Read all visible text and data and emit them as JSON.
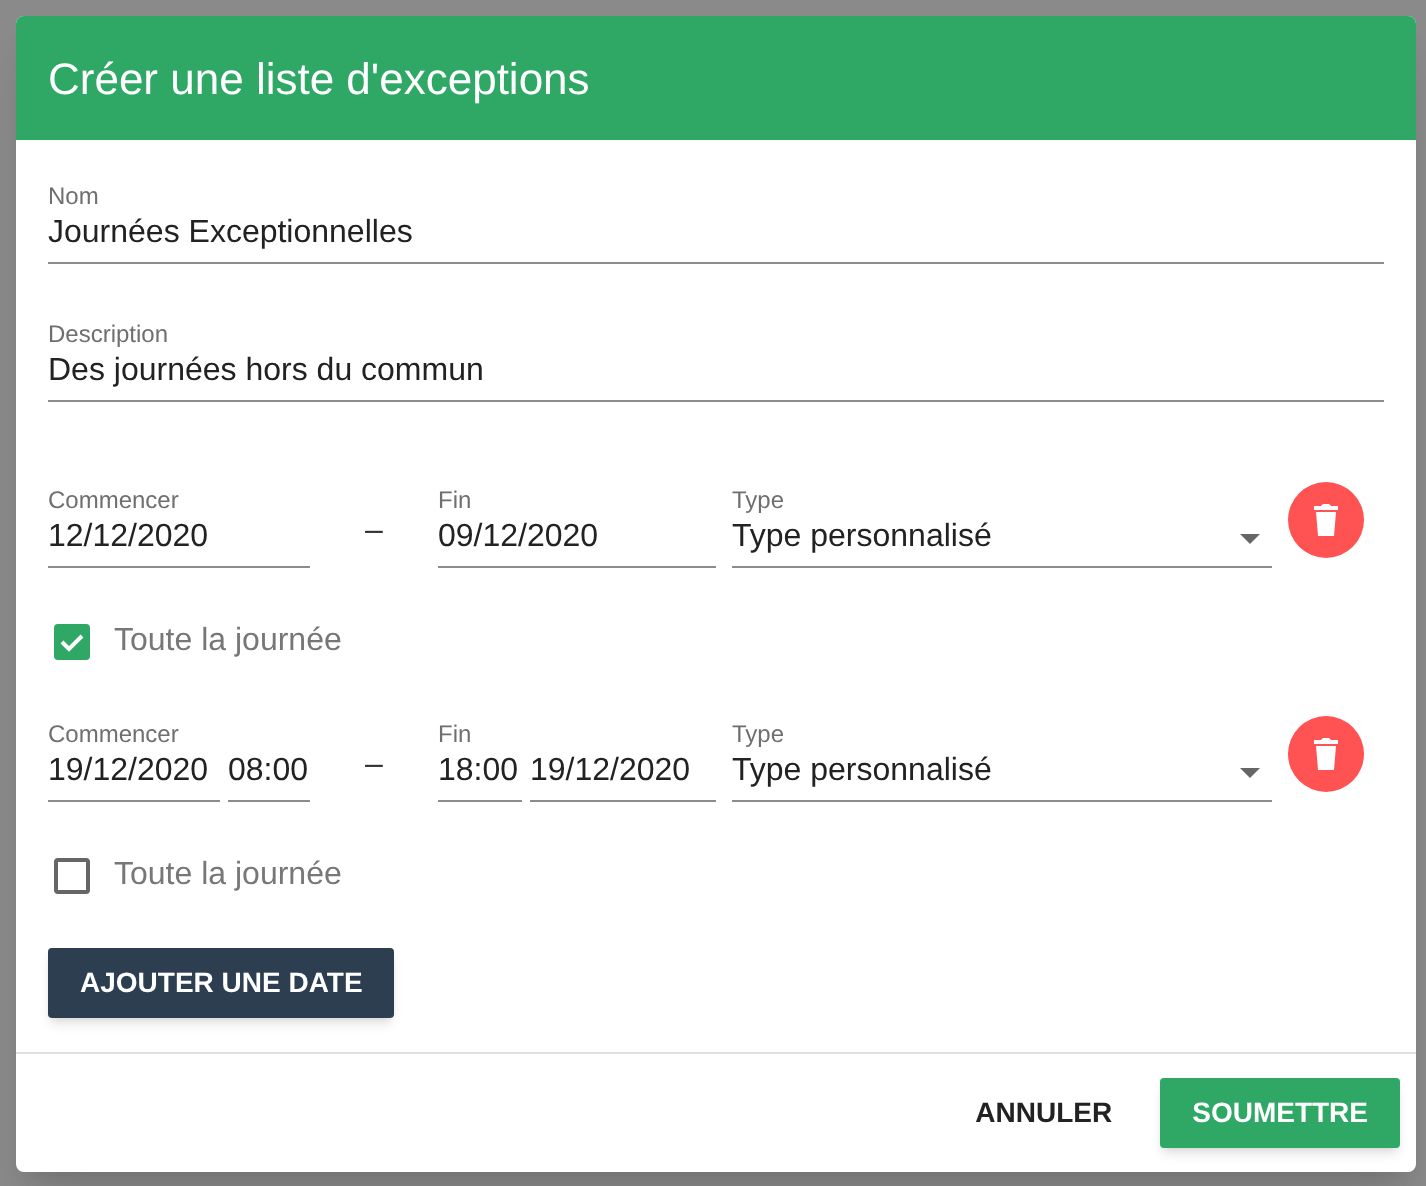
{
  "dialog": {
    "title": "Créer une liste d'exceptions",
    "fields": [
      {
        "label": "Nom",
        "value": "Journées Exceptionnelles"
      },
      {
        "label": "Description",
        "value": "Des journées hors du commun"
      }
    ],
    "dates": [
      {
        "start_label": "Commencer",
        "start_date": "12/12/2020",
        "separator": "–",
        "end_label": "Fin",
        "end_date": "09/12/2020",
        "type_label": "Type",
        "type": "Type personnalisé",
        "all_day": {
          "label": "Toute la journée",
          "checked": true
        }
      },
      {
        "start_label": "Commencer",
        "start_date": "19/12/2020",
        "start_time": "08:00",
        "separator": "–",
        "end_label": "Fin",
        "end_time": "18:00",
        "end_date": "19/12/2020",
        "type_label": "Type",
        "type": "Type personnalisé",
        "all_day": {
          "label": "Toute la journée",
          "checked": false
        }
      }
    ],
    "add_button": "AJOUTER UNE DATE",
    "buttons": [
      {
        "label": "ANNULER",
        "kind": "text"
      },
      {
        "label": "SOUMETTRE",
        "kind": "primary"
      }
    ]
  }
}
